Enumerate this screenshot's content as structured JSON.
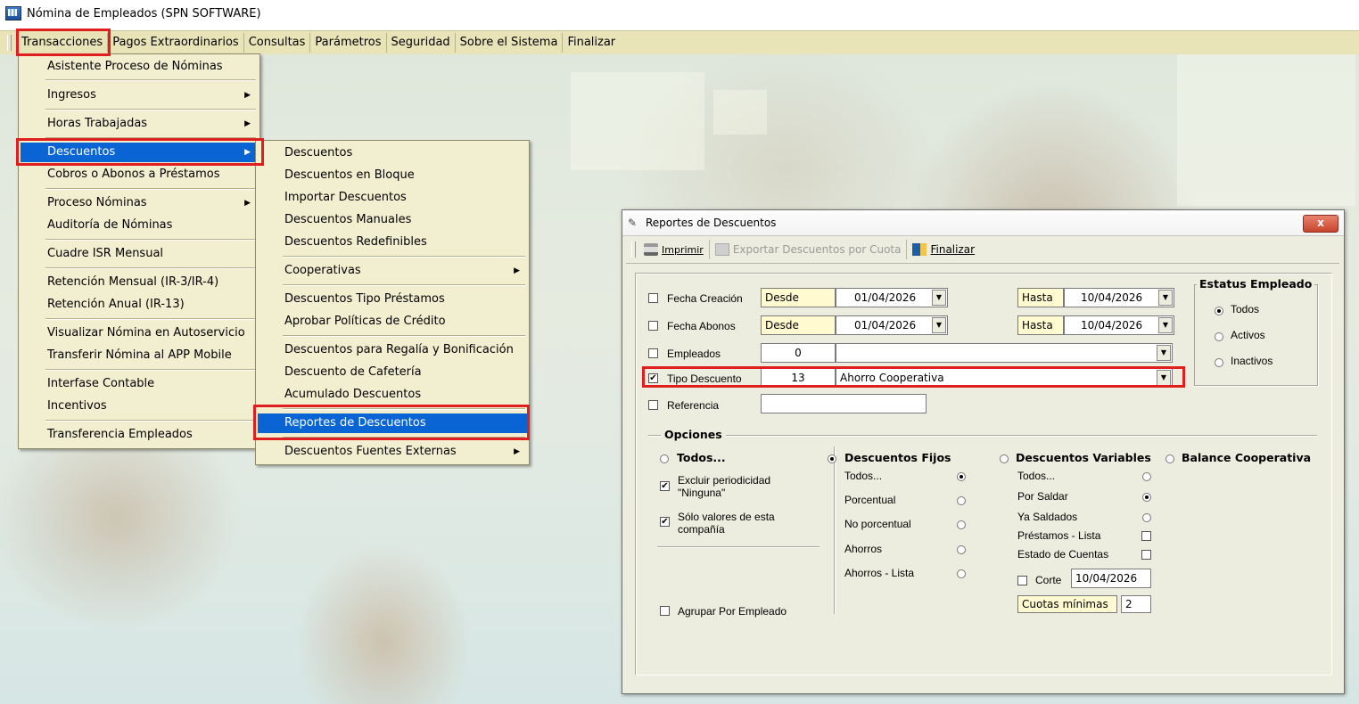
{
  "app": {
    "title": "Nómina de Empleados (SPN SOFTWARE)"
  },
  "menubar": {
    "items": [
      "Transacciones",
      "Pagos Extraordinarios",
      "Consultas",
      "Parámetros",
      "Seguridad",
      "Sobre el Sistema",
      "Finalizar"
    ]
  },
  "transacciones_menu": {
    "items": [
      "Asistente Proceso de Nóminas",
      "Ingresos",
      "Horas Trabajadas",
      "Descuentos",
      "Cobros o Abonos a Préstamos",
      "Proceso Nóminas",
      "Auditoría de Nóminas",
      "Cuadre ISR Mensual",
      "Retención Mensual  (IR-3/IR-4)",
      "Retención Anual  (IR-13)",
      "Visualizar Nómina en Autoservicio",
      "Transferir Nómina al APP Mobile",
      "Interfase Contable",
      "Incentivos",
      "Transferencia Empleados"
    ],
    "selected": "Descuentos"
  },
  "descuentos_menu": {
    "items": [
      "Descuentos",
      "Descuentos en Bloque",
      "Importar Descuentos",
      "Descuentos Manuales",
      "Descuentos Redefinibles",
      "Cooperativas",
      "Descuentos Tipo Préstamos",
      "Aprobar Políticas de Crédito",
      "Descuentos  para Regalía y Bonificación",
      "Descuento de Cafetería",
      "Acumulado Descuentos",
      "Reportes de Descuentos",
      "Descuentos Fuentes Externas"
    ],
    "selected": "Reportes de Descuentos"
  },
  "dialog": {
    "title": "Reportes de Descuentos",
    "close_label": "x",
    "toolbar": {
      "print": "Imprimir",
      "export": "Exportar Descuentos por Cuota",
      "exit": "Finalizar"
    },
    "filters": {
      "fecha_creacion": {
        "label": "Fecha Creación",
        "checked": false,
        "desde_label": "Desde",
        "desde": "01/04/2026",
        "hasta_label": "Hasta",
        "hasta": "10/04/2026"
      },
      "fecha_abonos": {
        "label": "Fecha Abonos",
        "checked": false,
        "desde_label": "Desde",
        "desde": "01/04/2026",
        "hasta_label": "Hasta",
        "hasta": "10/04/2026"
      },
      "empleados": {
        "label": "Empleados",
        "checked": false,
        "code": "0",
        "name": ""
      },
      "tipo_descuento": {
        "label": "Tipo Descuento",
        "checked": true,
        "code": "13",
        "name": "Ahorro Cooperativa"
      },
      "referencia": {
        "label": "Referencia",
        "checked": false,
        "value": ""
      }
    },
    "estatus": {
      "title": "Estatus Empleado",
      "options": [
        "Todos",
        "Activos",
        "Inactivos"
      ],
      "selected": "Todos"
    },
    "opciones": {
      "title": "Opciones",
      "todos": {
        "label": "Todos...",
        "selected": false
      },
      "excluir": {
        "label_1": "Excluir periodicidad",
        "label_2": "\"Ninguna\"",
        "checked": true
      },
      "solo_valores": {
        "label_1": "Sólo valores de esta",
        "label_2": "compañía",
        "checked": true
      },
      "agrupar": {
        "label": "Agrupar Por Empleado",
        "checked": false
      },
      "fijos": {
        "title": "Descuentos Fijos",
        "selected": true,
        "options": [
          "Todos...",
          "Porcentual",
          "No porcentual",
          "Ahorros",
          "Ahorros - Lista"
        ],
        "checked_option": "Todos..."
      },
      "variables": {
        "title": "Descuentos Variables",
        "selected": false,
        "options": [
          "Todos...",
          "Por Saldar",
          "Ya Saldados"
        ],
        "checked_option": "Por Saldar",
        "prestamos_lista": "Préstamos - Lista",
        "estado_cuentas": "Estado de Cuentas",
        "corte_label": "Corte",
        "corte_value": "10/04/2026",
        "cuotas_label": "Cuotas mínimas",
        "cuotas_value": "2"
      },
      "balance": {
        "label": "Balance Cooperativa",
        "selected": false
      }
    }
  },
  "colors": {
    "highlight": "#e01e1e",
    "menu_bg": "#f2eed0",
    "menubar_bg": "#e9e4b8",
    "selection": "#0a64d4"
  }
}
